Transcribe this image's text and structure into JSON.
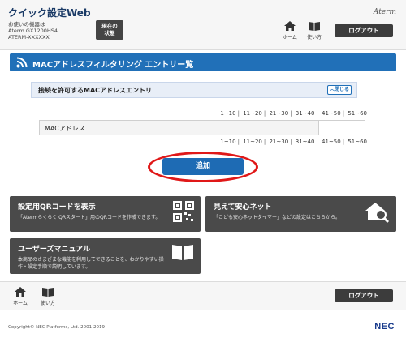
{
  "header": {
    "app_title": "クイック設定Web",
    "device_label": "お使いの機器は",
    "device_model": "Aterm GX1200HS4",
    "device_name": "ATERM-XXXXXX",
    "status_button_line1": "現在の",
    "status_button_line2": "状態",
    "brand": "Aterm",
    "home_label": "ホーム",
    "help_label": "使い方",
    "logout_label": "ログアウト"
  },
  "page": {
    "title": "MACアドレスフィルタリング エントリー覧"
  },
  "section": {
    "title": "接続を許可するMACアドレスエントリ",
    "close_label": "閉じる"
  },
  "pager": [
    "1~10",
    "11~20",
    "21~30",
    "31~40",
    "41~50",
    "51~60"
  ],
  "table": {
    "column_header": "MACアドレス"
  },
  "actions": {
    "add_label": "追加"
  },
  "cards": {
    "qr": {
      "title": "設定用QRコードを表示",
      "desc": "「Atermらくらく QRスタート」用のQRコードを作成できます。"
    },
    "safety": {
      "title": "見えて安心ネット",
      "desc": "「こども安心ネットタイマー」などの設定はこちらから。"
    },
    "manual": {
      "title": "ユーザーズマニュアル",
      "desc_line1": "本商品のさまざまな機能を利用してできることを、わかりやすい操",
      "desc_line2": "作・設定手順で説明しています。"
    }
  },
  "footer": {
    "home_label": "ホーム",
    "help_label": "使い方",
    "logout_label": "ログアウト",
    "copyright": "Copyright© NEC Platforms, Ltd. 2001-2019",
    "maker": "NEC"
  },
  "colors": {
    "title_bar": "#2170b8",
    "add_button": "#1e6bb4",
    "highlight_ring": "#e01818",
    "card_bg": "#4a4a4a"
  }
}
